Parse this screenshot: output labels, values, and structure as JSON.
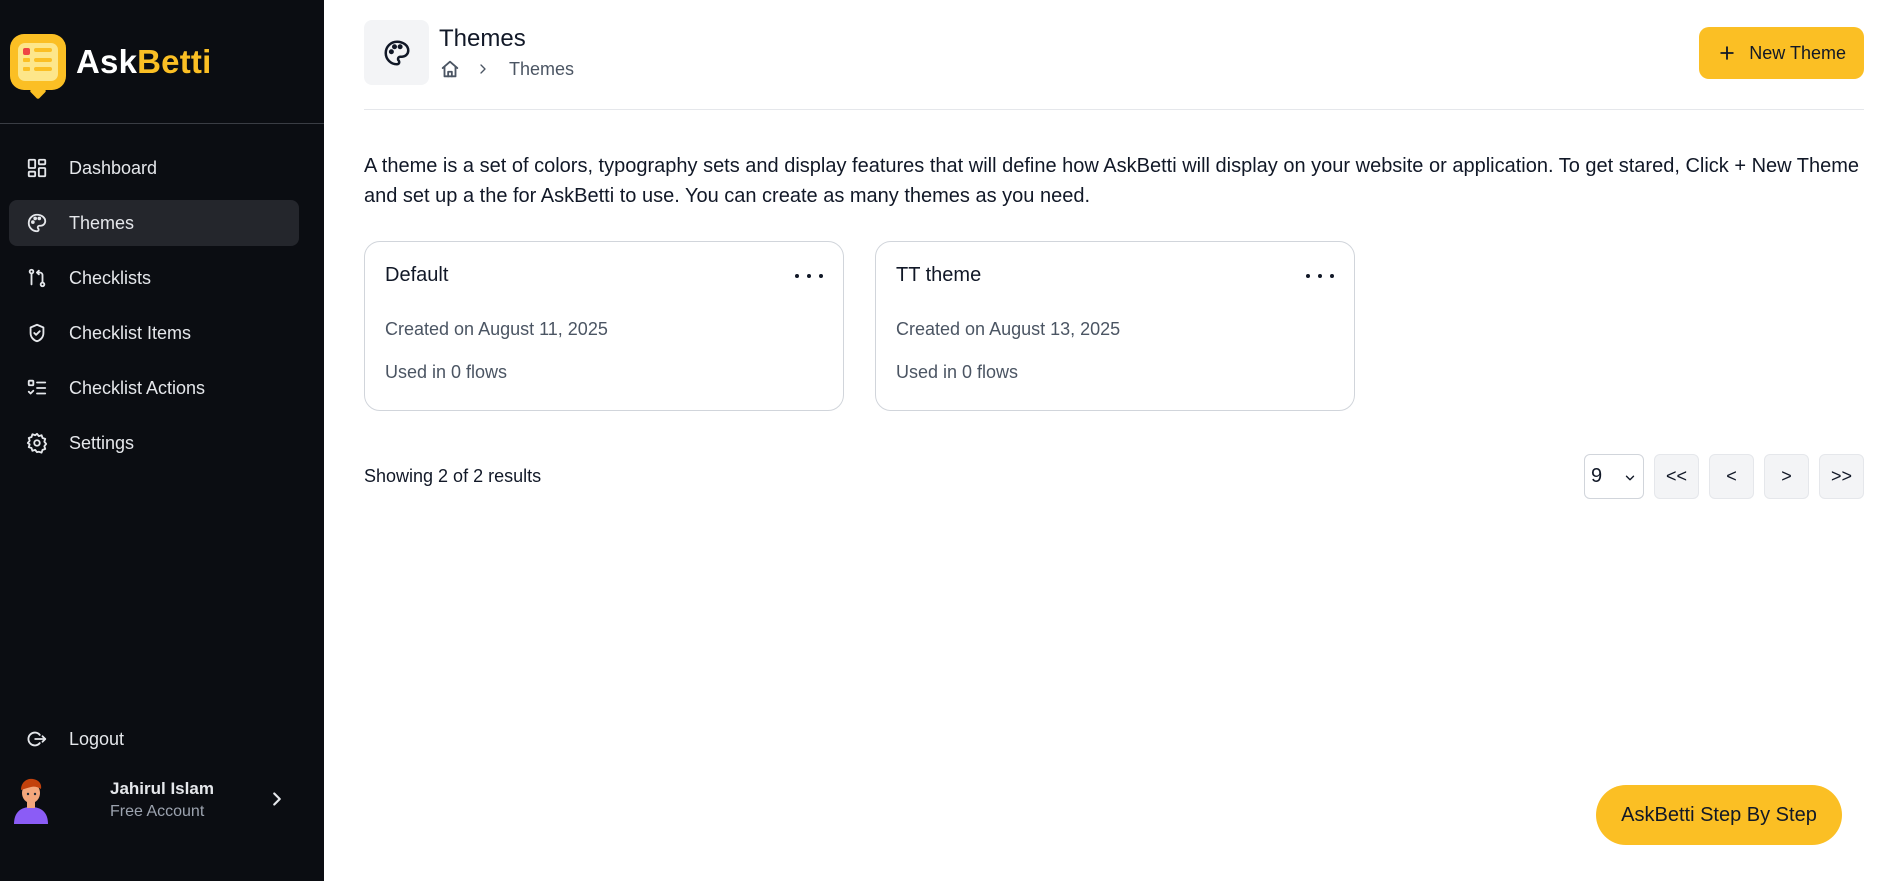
{
  "brand": {
    "name_part1": "Ask",
    "name_part2": "Betti",
    "accent": "#fbbf24",
    "logo_icon": "checklist-chat-logo"
  },
  "sidebar": {
    "items": [
      {
        "label": "Dashboard",
        "icon": "dashboard-icon",
        "active": false
      },
      {
        "label": "Themes",
        "icon": "palette-icon",
        "active": true
      },
      {
        "label": "Checklists",
        "icon": "git-compare-icon",
        "active": false
      },
      {
        "label": "Checklist Items",
        "icon": "shield-check-icon",
        "active": false
      },
      {
        "label": "Checklist Actions",
        "icon": "list-checks-icon",
        "active": false
      },
      {
        "label": "Settings",
        "icon": "gear-icon",
        "active": false
      }
    ],
    "logout_label": "Logout",
    "user": {
      "name": "Jahirul Islam",
      "plan": "Free Account"
    }
  },
  "header": {
    "title": "Themes",
    "breadcrumb": {
      "home_icon": "home-icon",
      "current": "Themes"
    },
    "new_button_label": "New Theme"
  },
  "intro_text": "A theme is a set of colors, typography sets and display features that will define how AskBetti will display on your website or application. To get stared, Click + New Theme and set up a the for AskBetti to use. You can create as many themes as you need.",
  "themes": [
    {
      "name": "Default",
      "created": "Created on August 11, 2025",
      "used": "Used in 0 flows"
    },
    {
      "name": "TT theme",
      "created": "Created on August 13, 2025",
      "used": "Used in 0 flows"
    }
  ],
  "pagination": {
    "showing": "Showing 2 of 2 results",
    "per_page": "9",
    "first": "<<",
    "prev": "<",
    "next": ">",
    "last": ">>"
  },
  "help_button_label": "AskBetti Step By Step"
}
